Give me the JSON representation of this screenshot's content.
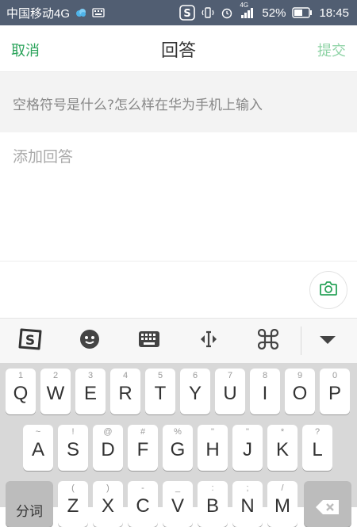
{
  "status_bar": {
    "carrier": "中国移动4G",
    "battery": "52%",
    "time": "18:45",
    "network_small": "4G"
  },
  "header": {
    "cancel": "取消",
    "title": "回答",
    "submit": "提交"
  },
  "question": {
    "text": "空格符号是什么?怎么样在华为手机上输入"
  },
  "answer": {
    "placeholder": "添加回答"
  },
  "keyboard": {
    "row1": [
      {
        "num": "1",
        "key": "Q"
      },
      {
        "num": "2",
        "key": "W"
      },
      {
        "num": "3",
        "key": "E"
      },
      {
        "num": "4",
        "key": "R"
      },
      {
        "num": "5",
        "key": "T"
      },
      {
        "num": "6",
        "key": "Y"
      },
      {
        "num": "7",
        "key": "U"
      },
      {
        "num": "8",
        "key": "I"
      },
      {
        "num": "9",
        "key": "O"
      },
      {
        "num": "0",
        "key": "P"
      }
    ],
    "row2": [
      {
        "num": "~",
        "key": "A"
      },
      {
        "num": "!",
        "key": "S"
      },
      {
        "num": "@",
        "key": "D"
      },
      {
        "num": "#",
        "key": "F"
      },
      {
        "num": "%",
        "key": "G"
      },
      {
        "num": "\"",
        "key": "H"
      },
      {
        "num": "\"",
        "key": "J"
      },
      {
        "num": "*",
        "key": "K"
      },
      {
        "num": "?",
        "key": "L"
      }
    ],
    "row3": [
      {
        "num": "(",
        "key": "Z"
      },
      {
        "num": ")",
        "key": "X"
      },
      {
        "num": "-",
        "key": "C"
      },
      {
        "num": "_",
        "key": "V"
      },
      {
        "num": ":",
        "key": "B"
      },
      {
        "num": ";",
        "key": "N"
      },
      {
        "num": "/",
        "key": "M"
      }
    ],
    "fenci_label": "分词"
  },
  "colors": {
    "accent_green": "#2aa35a",
    "submit_disabled": "#8fd3a6",
    "status_bar_bg": "#515e72"
  },
  "icons": [
    "sogou-logo-icon",
    "emoji-icon",
    "keyboard-icon",
    "cursor-move-icon",
    "command-icon",
    "collapse-keyboard-icon",
    "camera-icon",
    "backspace-icon"
  ]
}
